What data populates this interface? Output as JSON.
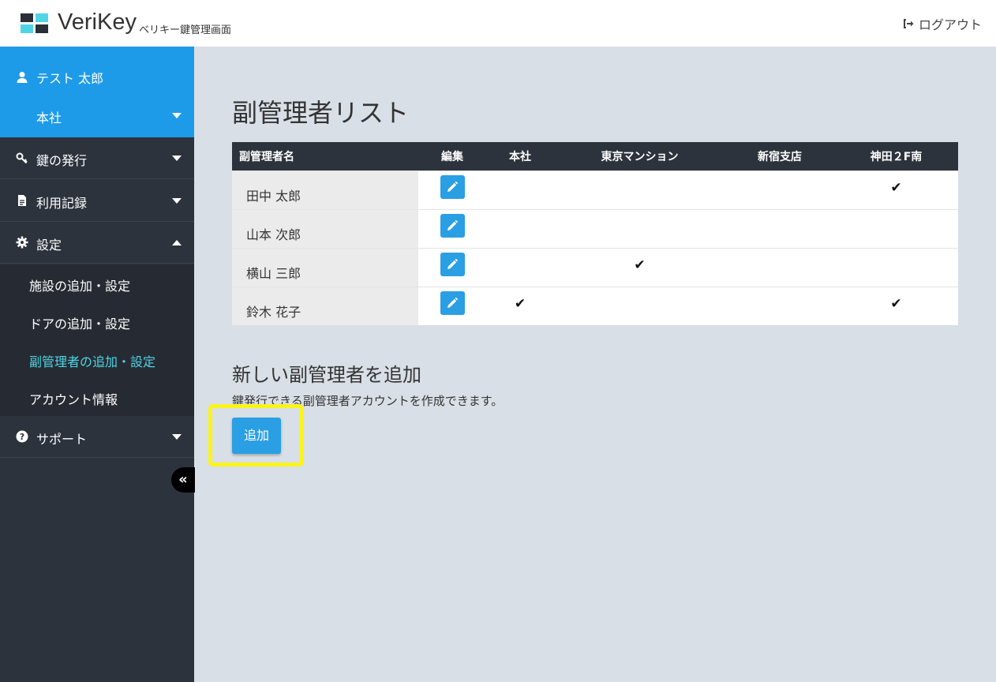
{
  "header": {
    "brand": "VeriKey",
    "subtitle": "ベリキー鍵管理画面",
    "logout_label": "ログアウト"
  },
  "sidebar": {
    "user_name": "テスト 太郎",
    "branch": "本社",
    "nav": [
      {
        "label": "鍵の発行",
        "icon": "key-icon",
        "expanded": false
      },
      {
        "label": "利用記録",
        "icon": "document-icon",
        "expanded": false
      },
      {
        "label": "設定",
        "icon": "gear-icon",
        "expanded": true
      },
      {
        "label": "サポート",
        "icon": "question-icon",
        "expanded": false
      }
    ],
    "settings_submenu": [
      {
        "label": "施設の追加・設定",
        "active": false
      },
      {
        "label": "ドアの追加・設定",
        "active": false
      },
      {
        "label": "副管理者の追加・設定",
        "active": true
      },
      {
        "label": "アカウント情報",
        "active": false
      }
    ],
    "collapse_label": "«"
  },
  "main": {
    "title": "副管理者リスト",
    "table": {
      "headers": [
        "副管理者名",
        "編集",
        "本社",
        "東京マンション",
        "新宿支店",
        "神田２F南"
      ],
      "rows": [
        {
          "name": "田中 太郎",
          "checks": [
            false,
            false,
            false,
            true
          ]
        },
        {
          "name": "山本 次郎",
          "checks": [
            false,
            false,
            false,
            false
          ]
        },
        {
          "name": "横山 三郎",
          "checks": [
            false,
            true,
            false,
            false
          ]
        },
        {
          "name": "鈴木 花子",
          "checks": [
            true,
            false,
            false,
            true
          ]
        }
      ],
      "check_glyph": "✔"
    },
    "add_section": {
      "title": "新しい副管理者を追加",
      "description": "鍵発行できる副管理者アカウントを作成できます。",
      "button_label": "追加"
    }
  },
  "colors": {
    "accent": "#1e9be8",
    "sidebar_bg": "#2d333d",
    "active_link": "#4fd5e6",
    "highlight": "#fbf41a"
  }
}
